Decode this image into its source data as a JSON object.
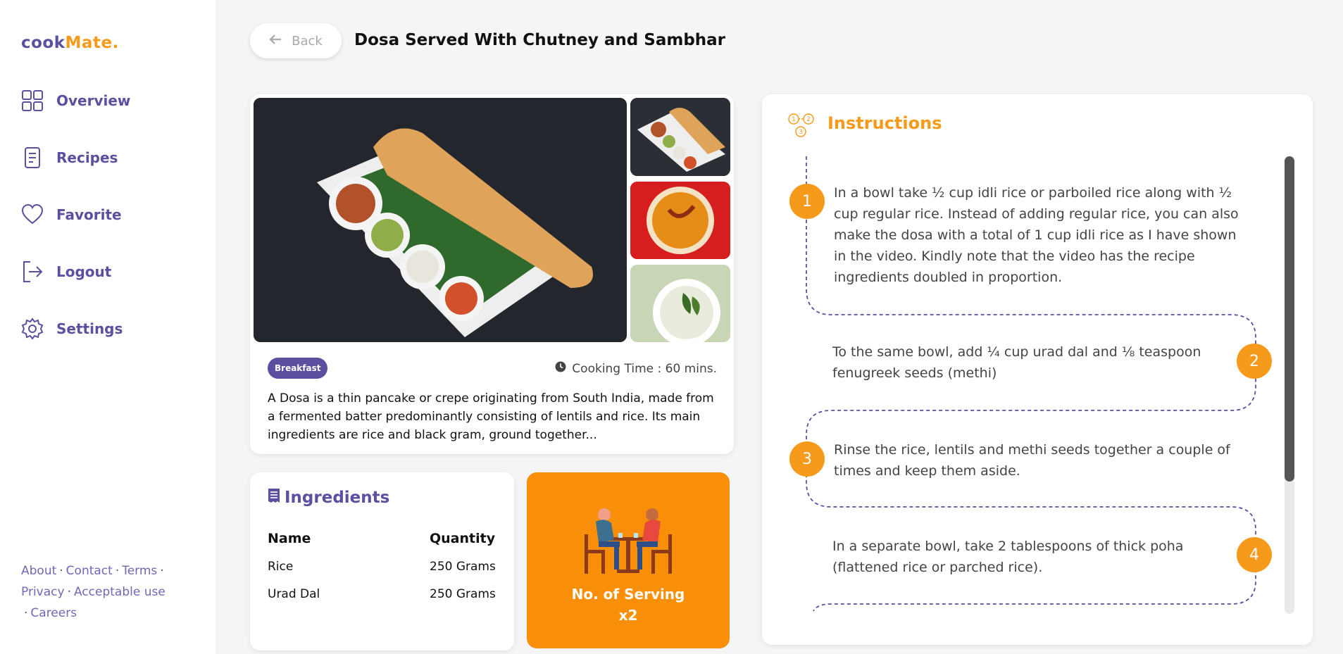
{
  "brand": {
    "part1": "cook",
    "part2": "Mate."
  },
  "sidebar": {
    "items": [
      {
        "label": "Overview",
        "icon": "grid-icon"
      },
      {
        "label": "Recipes",
        "icon": "document-icon"
      },
      {
        "label": "Favorite",
        "icon": "heart-icon"
      },
      {
        "label": "Logout",
        "icon": "logout-icon"
      },
      {
        "label": "Settings",
        "icon": "gear-icon"
      }
    ],
    "footer_links": [
      "About",
      "Contact",
      "Terms",
      "Privacy",
      "Acceptable use",
      "Careers"
    ]
  },
  "header": {
    "back_label": "Back",
    "title": "Dosa Served With Chutney and Sambhar"
  },
  "recipe": {
    "category": "Breakfast",
    "cooking_time": "Cooking Time : 60 mins.",
    "description": "A Dosa is a thin pancake or crepe originating from South India, made from a fermented batter predominantly consisting of lentils and rice. Its main ingredients are rice and black gram, ground together..."
  },
  "ingredients": {
    "title": "Ingredients",
    "headers": [
      "Name",
      "Quantity"
    ],
    "rows": [
      {
        "name": "Rice",
        "quantity": "250 Grams"
      },
      {
        "name": "Urad Dal",
        "quantity": "250 Grams"
      }
    ]
  },
  "serving": {
    "label": "No. of Serving",
    "count": "x2"
  },
  "instructions": {
    "title": "Instructions",
    "steps": [
      {
        "num": "1",
        "text": "In a bowl take ½ cup idli rice or parboiled rice along with ½ cup regular rice. Instead of adding regular rice, you can also make the dosa with a total of 1 cup idli rice as I have shown in the video. Kindly note that the video has the recipe ingredients doubled in proportion."
      },
      {
        "num": "2",
        "text": "To the same bowl, add ¼ cup urad dal and ⅛ teaspoon fenugreek seeds (methi)"
      },
      {
        "num": "3",
        "text": "Rinse the rice, lentils and methi seeds together a couple of times and keep them aside."
      },
      {
        "num": "4",
        "text": "In a separate bowl, take 2 tablespoons of thick poha (flattened rice or parched rice)."
      }
    ],
    "scroll_fraction": 0.71
  },
  "colors": {
    "primary": "#5b4fa0",
    "accent": "#f59a1a",
    "serving_bg": "#f98f08"
  }
}
